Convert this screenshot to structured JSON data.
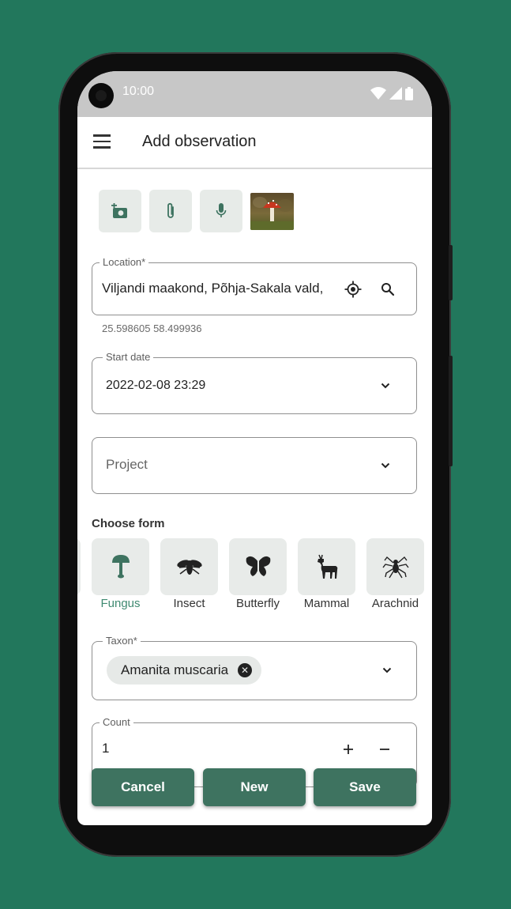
{
  "status_bar": {
    "time": "10:00"
  },
  "app_bar": {
    "title": "Add observation",
    "menu_icon": "hamburger-menu-icon"
  },
  "media": {
    "buttons": [
      {
        "name": "add-photo-button",
        "icon": "add-photo-icon"
      },
      {
        "name": "attach-file-button",
        "icon": "paperclip-icon"
      },
      {
        "name": "record-audio-button",
        "icon": "microphone-icon"
      }
    ],
    "thumbnail": "fly agaric mushroom photo"
  },
  "location": {
    "label": "Location*",
    "value": "Viljandi maakond, Põhja-Sakala vald,",
    "coordinates": "25.598605 58.499936"
  },
  "start_date": {
    "label": "Start date",
    "value": "2022-02-08 23:29"
  },
  "project": {
    "placeholder": "Project"
  },
  "choose_form": {
    "title": "Choose form",
    "items": [
      {
        "label": "",
        "icon": "partial-form-icon"
      },
      {
        "label": "Fungus",
        "icon": "mushroom-icon",
        "active": true
      },
      {
        "label": "Insect",
        "icon": "insect-icon"
      },
      {
        "label": "Butterfly",
        "icon": "butterfly-icon"
      },
      {
        "label": "Mammal",
        "icon": "deer-icon"
      },
      {
        "label": "Arachnid",
        "icon": "spider-icon"
      }
    ]
  },
  "taxon": {
    "label": "Taxon*",
    "chip": "Amanita muscaria"
  },
  "count": {
    "label": "Count",
    "value": "1"
  },
  "actions": {
    "cancel": "Cancel",
    "new": "New",
    "save": "Save"
  },
  "colors": {
    "background": "#22775c",
    "accent": "#3e7360",
    "active_label": "#3f8a71",
    "tile": "#e8ebe9"
  }
}
